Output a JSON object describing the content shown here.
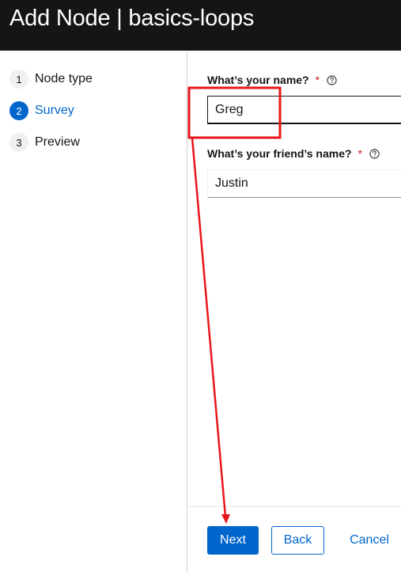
{
  "header": {
    "title": "Add Node | basics-loops"
  },
  "wizard": {
    "steps": [
      {
        "number": "1",
        "label": "Node type",
        "active": false
      },
      {
        "number": "2",
        "label": "Survey",
        "active": true
      },
      {
        "number": "3",
        "label": "Preview",
        "active": false
      }
    ]
  },
  "survey": {
    "name_field": {
      "label": "What’s your name?",
      "required": "*",
      "value": "Greg"
    },
    "friend_field": {
      "label": "What’s your friend’s name?",
      "required": "*",
      "value": "Justin"
    }
  },
  "footer": {
    "next_label": "Next",
    "back_label": "Back",
    "cancel_label": "Cancel"
  },
  "colors": {
    "header_bg": "#151515",
    "primary": "#0066cc",
    "required": "#c9190b",
    "annotation": "#e8161b"
  },
  "icons": {
    "help": "question-circle-icon"
  }
}
